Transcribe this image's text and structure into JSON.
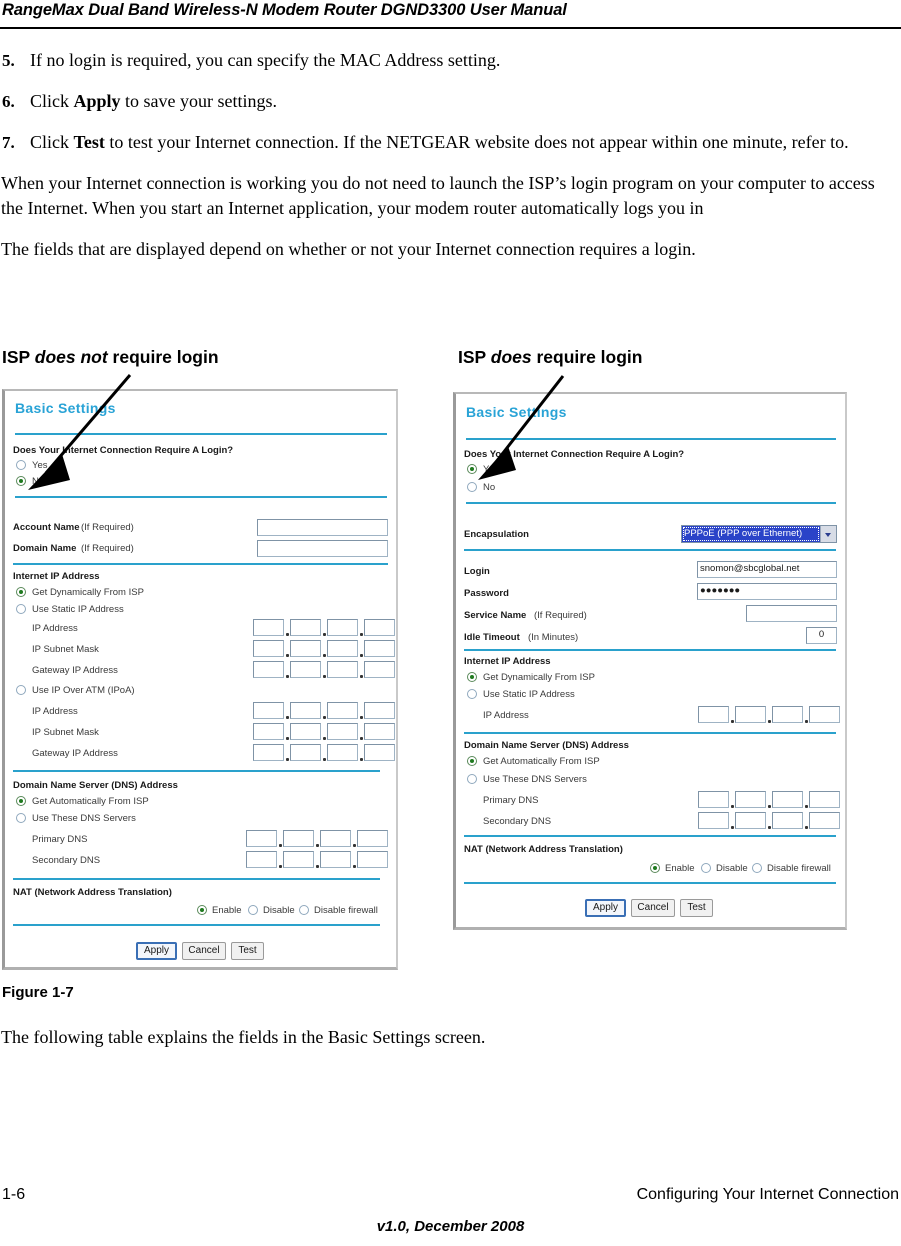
{
  "header": {
    "title": "RangeMax Dual Band Wireless-N Modem Router DGND3300 User Manual"
  },
  "steps": [
    {
      "num": "5.",
      "text_parts": [
        "If no login is required, you can specify the MAC Address setting."
      ]
    },
    {
      "num": "6.",
      "pre": "Click ",
      "bold": "Apply",
      "post": " to save your settings."
    },
    {
      "num": "7.",
      "pre": "Click ",
      "bold": "Test",
      "post": " to test your Internet connection. If the NETGEAR website does not appear within one minute, refer to."
    }
  ],
  "paragraphs": {
    "p1": "When your Internet connection is working you do not need to launch the ISP’s login program on your computer to access the Internet. When you start an Internet application, your modem router automatically logs you in",
    "p2": "The fields that are displayed depend on whether or not your Internet connection requires a login."
  },
  "figure_labels": {
    "left_pre": "ISP ",
    "left_ital": "does not",
    "left_post": " require login",
    "right_pre": "ISP ",
    "right_ital": "does",
    "right_post": " require login"
  },
  "panel_left": {
    "title": "Basic Settings",
    "login_question": "Does Your Internet Connection Require A Login?",
    "login_yes": "Yes",
    "login_no": "No",
    "login_selected": "No",
    "account_name_label": "Account Name",
    "account_name_hint": "(If Required)",
    "account_name_value": "",
    "domain_name_label": "Domain Name",
    "domain_name_hint": "(If Required)",
    "domain_name_value": "",
    "internet_ip_heading": "Internet IP Address",
    "opt_get_dynamically": "Get Dynamically From ISP",
    "opt_use_static": "Use Static IP Address",
    "opt_use_ipoa": "Use IP Over ATM (IPoA)",
    "internet_ip_selected": "Get Dynamically From ISP",
    "lbl_ip_address": "IP Address",
    "lbl_ip_subnet": "IP Subnet Mask",
    "lbl_gateway": "Gateway IP Address",
    "dns_heading": "Domain Name Server (DNS) Address",
    "dns_auto": "Get Automatically From ISP",
    "dns_manual": "Use These DNS Servers",
    "dns_selected": "Get Automatically From ISP",
    "lbl_primary_dns": "Primary DNS",
    "lbl_secondary_dns": "Secondary DNS",
    "nat_heading": "NAT (Network Address Translation)",
    "nat_enable": "Enable",
    "nat_disable": "Disable",
    "nat_disable_firewall": "Disable firewall",
    "nat_selected": "Enable",
    "btn_apply": "Apply",
    "btn_cancel": "Cancel",
    "btn_test": "Test"
  },
  "panel_right": {
    "title": "Basic Settings",
    "login_question": "Does Your Internet Connection Require A Login?",
    "login_yes": "Yes",
    "login_no": "No",
    "login_selected": "Yes",
    "encapsulation_label": "Encapsulation",
    "encapsulation_value": "PPPoE (PPP over Ethernet)",
    "login_label": "Login",
    "login_value": "snomon@sbcglobal.net",
    "password_label": "Password",
    "password_value": "●●●●●●●",
    "service_name_label": "Service Name",
    "service_name_hint": "(If Required)",
    "service_name_value": "",
    "idle_timeout_label": "Idle Timeout",
    "idle_timeout_hint": "(In Minutes)",
    "idle_timeout_value": "0",
    "internet_ip_heading": "Internet IP Address",
    "opt_get_dynamically": "Get Dynamically From ISP",
    "opt_use_static": "Use Static IP Address",
    "internet_ip_selected": "Get Dynamically From ISP",
    "lbl_ip_address": "IP Address",
    "dns_heading": "Domain Name Server (DNS) Address",
    "dns_auto": "Get Automatically From ISP",
    "dns_manual": "Use These DNS Servers",
    "dns_selected": "Get Automatically From ISP",
    "lbl_primary_dns": "Primary DNS",
    "lbl_secondary_dns": "Secondary DNS",
    "nat_heading": "NAT (Network Address Translation)",
    "nat_enable": "Enable",
    "nat_disable": "Disable",
    "nat_disable_firewall": "Disable firewall",
    "nat_selected": "Enable",
    "btn_apply": "Apply",
    "btn_cancel": "Cancel",
    "btn_test": "Test"
  },
  "figure_caption": "Figure 1-7",
  "after_figure_text": "The following table explains the fields in the Basic Settings screen.",
  "footer": {
    "page_number": "1-6",
    "chapter": "Configuring Your Internet Connection",
    "version": "v1.0, December 2008"
  },
  "colors": {
    "teal_rule": "#2aa1cc",
    "panel_title": "#29a3d6",
    "dropdown_highlight": "#2a43c8",
    "radio_on": "#1f7a1f"
  }
}
